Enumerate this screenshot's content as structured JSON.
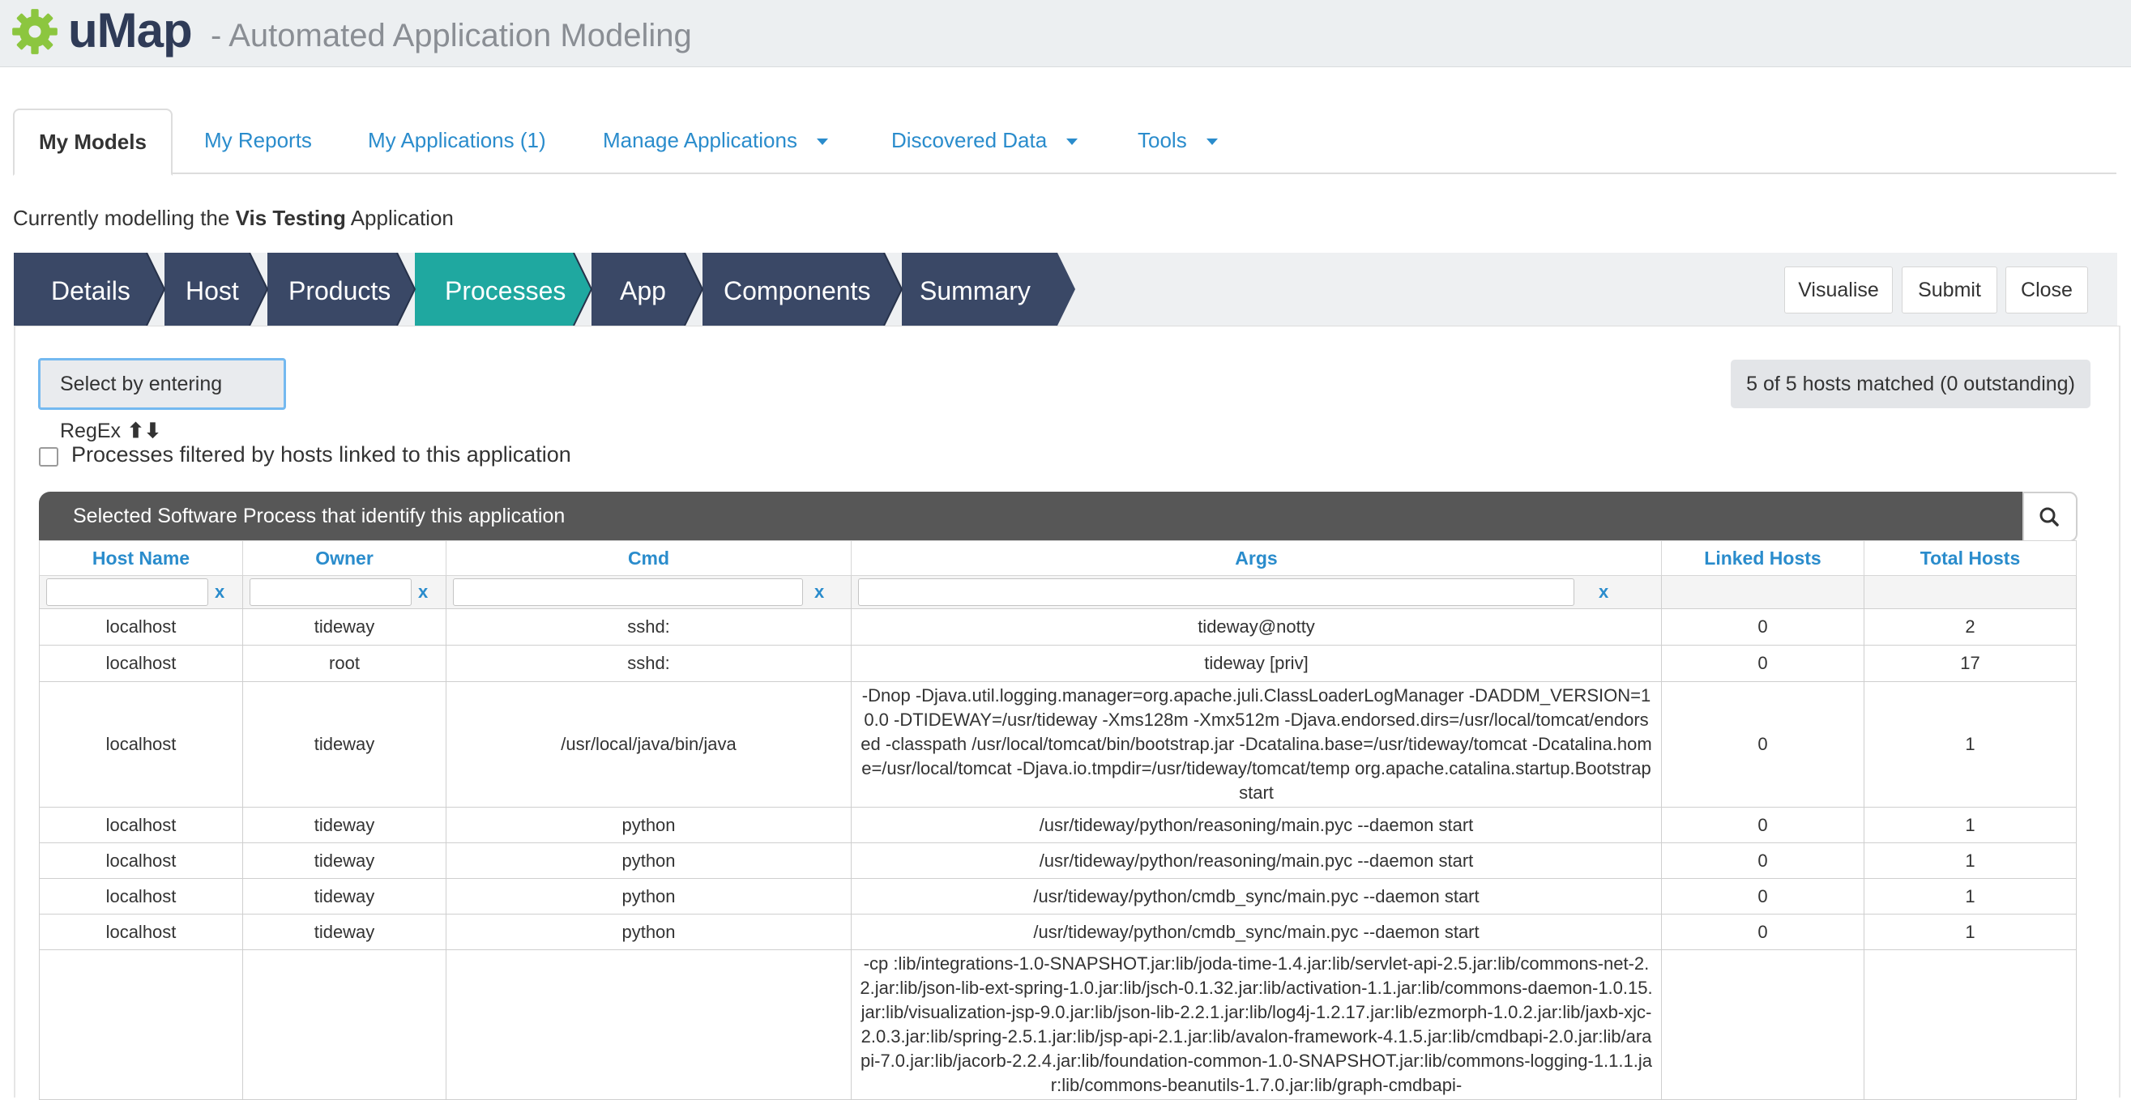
{
  "header": {
    "brand": "uMap",
    "tagline": "- Automated Application Modeling",
    "logo_icon": "gear-icon",
    "logo_color": "#8cc63f"
  },
  "tabs": [
    {
      "label": "My Models",
      "active": true
    },
    {
      "label": "My Reports"
    },
    {
      "label": "My Applications (1)"
    },
    {
      "label": "Manage Applications",
      "dropdown": true
    },
    {
      "label": "Discovered Data",
      "dropdown": true
    },
    {
      "label": "Tools",
      "dropdown": true
    }
  ],
  "modelling": {
    "prefix": "Currently modelling the",
    "app_name": "Vis Testing",
    "suffix": "Application"
  },
  "steps": [
    "Details",
    "Host",
    "Products",
    "Processes",
    "App",
    "Components",
    "Summary"
  ],
  "active_step": "Processes",
  "step_colors": {
    "normal": "#3a4866",
    "active": "#1fa8a0"
  },
  "actions": {
    "visualise": "Visualise",
    "submit": "Submit",
    "close": "Close"
  },
  "regex_button": {
    "label": "Select by entering RegEx",
    "icon": "sort-arrows-icon",
    "arrows": "⬆⬇"
  },
  "matched_status": "5 of 5 hosts matched (0 outstanding)",
  "filter_checkbox": {
    "label": "Processes filtered by hosts linked to this application",
    "checked": false
  },
  "table": {
    "title": "Selected Software Process that identify this application",
    "search_icon": "search-icon",
    "columns": [
      "Host Name",
      "Owner",
      "Cmd",
      "Args",
      "Linked Hosts",
      "Total Hosts"
    ],
    "filter_clear": "x",
    "rows": [
      {
        "host": "localhost",
        "owner": "tideway",
        "cmd": "sshd:",
        "args": "tideway@notty",
        "linked": "0",
        "total": "2"
      },
      {
        "host": "localhost",
        "owner": "root",
        "cmd": "sshd:",
        "args": "tideway [priv]",
        "linked": "0",
        "total": "17"
      },
      {
        "host": "localhost",
        "owner": "tideway",
        "cmd": "/usr/local/java/bin/java",
        "args": "-Dnop -Djava.util.logging.manager=org.apache.juli.ClassLoaderLogManager -DADDM_VERSION=10.0 -DTIDEWAY=/usr/tideway -Xms128m -Xmx512m -Djava.endorsed.dirs=/usr/local/tomcat/endorsed -classpath /usr/local/tomcat/bin/bootstrap.jar -Dcatalina.base=/usr/tideway/tomcat -Dcatalina.home=/usr/local/tomcat -Djava.io.tmpdir=/usr/tideway/tomcat/temp org.apache.catalina.startup.Bootstrap start",
        "linked": "0",
        "total": "1"
      },
      {
        "host": "localhost",
        "owner": "tideway",
        "cmd": "python",
        "args": "/usr/tideway/python/reasoning/main.pyc --daemon start",
        "linked": "0",
        "total": "1"
      },
      {
        "host": "localhost",
        "owner": "tideway",
        "cmd": "python",
        "args": "/usr/tideway/python/reasoning/main.pyc --daemon start",
        "linked": "0",
        "total": "1"
      },
      {
        "host": "localhost",
        "owner": "tideway",
        "cmd": "python",
        "args": "/usr/tideway/python/cmdb_sync/main.pyc --daemon start",
        "linked": "0",
        "total": "1"
      },
      {
        "host": "localhost",
        "owner": "tideway",
        "cmd": "python",
        "args": "/usr/tideway/python/cmdb_sync/main.pyc --daemon start",
        "linked": "0",
        "total": "1"
      },
      {
        "host": "",
        "owner": "",
        "cmd": "",
        "args": "-cp :lib/integrations-1.0-SNAPSHOT.jar:lib/joda-time-1.4.jar:lib/servlet-api-2.5.jar:lib/commons-net-2.2.jar:lib/json-lib-ext-spring-1.0.jar:lib/jsch-0.1.32.jar:lib/activation-1.1.jar:lib/commons-daemon-1.0.15.jar:lib/visualization-jsp-9.0.jar:lib/json-lib-2.2.1.jar:lib/log4j-1.2.17.jar:lib/ezmorph-1.0.2.jar:lib/jaxb-xjc-2.0.3.jar:lib/spring-2.5.1.jar:lib/jsp-api-2.1.jar:lib/avalon-framework-4.1.5.jar:lib/cmdbapi-2.0.jar:lib/arapi-7.0.jar:lib/jacorb-2.2.4.jar:lib/foundation-common-1.0-SNAPSHOT.jar:lib/commons-logging-1.1.1.jar:lib/commons-beanutils-1.7.0.jar:lib/graph-cmdbapi-",
        "linked": "",
        "total": ""
      }
    ]
  }
}
